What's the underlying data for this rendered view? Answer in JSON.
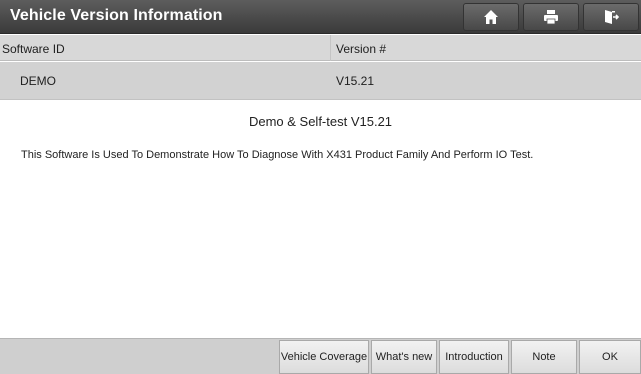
{
  "window": {
    "title": "Vehicle Version Information",
    "icons": [
      "home-icon",
      "print-icon",
      "exit-icon"
    ]
  },
  "table": {
    "headers": [
      "Software ID",
      "Version #"
    ],
    "rows": [
      [
        "DEMO",
        "V15.21"
      ]
    ]
  },
  "details": {
    "heading": "Demo & Self-test V15.21",
    "description": "This Software Is Used To Demonstrate How To Diagnose With X431 Product Family And Perform IO Test."
  },
  "buttons": {
    "vehicle_coverage": "Vehicle Coverage",
    "whats_new": "What's new",
    "introduction": "Introduction",
    "note": "Note",
    "ok": "OK"
  },
  "colors": {
    "titlebar": "#4a4a4a",
    "header_row": "#d8d8d8",
    "data_row": "#d2d2d2",
    "bottom_bar": "#cfcfcf"
  }
}
